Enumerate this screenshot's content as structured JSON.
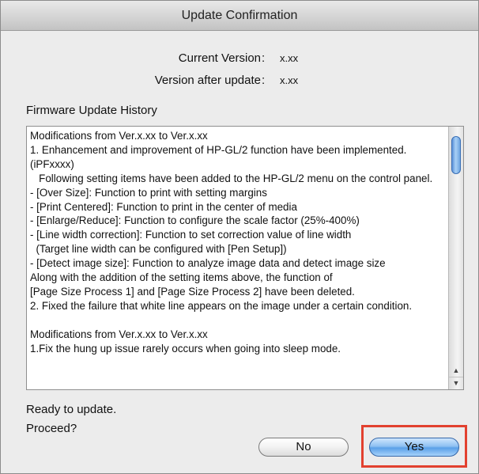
{
  "window": {
    "title": "Update Confirmation"
  },
  "versions": {
    "current_label": "Current Version",
    "current_value": "x.xx",
    "after_label": "Version after update",
    "after_value": "x.xx",
    "colon": ":"
  },
  "history": {
    "label": "Firmware Update History",
    "text": "Modifications from Ver.x.xx to Ver.x.xx\n1. Enhancement and improvement of HP-GL/2 function have been implemented. (iPFxxxx)\n   Following setting items have been added to the HP-GL/2 menu on the control panel.\n- [Over Size]: Function to print with setting margins\n- [Print Centered]: Function to print in the center of media\n- [Enlarge/Reduce]: Function to configure the scale factor (25%-400%)\n- [Line width correction]: Function to set correction value of line width\n  (Target line width can be configured with [Pen Setup])\n- [Detect image size]: Function to analyze image data and detect image size\nAlong with the addition of the setting items above, the function of\n[Page Size Process 1] and [Page Size Process 2] have been deleted.\n2. Fixed the failure that white line appears on the image under a certain condition.\n\nModifications from Ver.x.xx to Ver.x.xx\n1.Fix the hung up issue rarely occurs when going into sleep mode."
  },
  "status": {
    "line1": "Ready to update.",
    "line2": "Proceed?"
  },
  "buttons": {
    "no_label": "No",
    "yes_label": "Yes"
  },
  "colors": {
    "highlight": "#e2412f",
    "default_button": "#5aa0e8"
  }
}
